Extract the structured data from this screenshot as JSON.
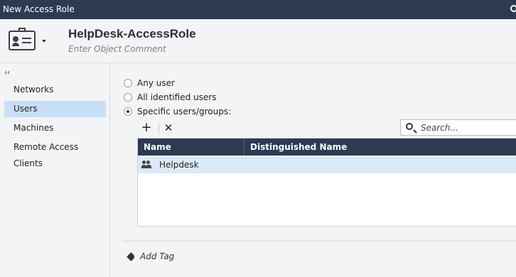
{
  "window": {
    "title": "New Access Role"
  },
  "header": {
    "name": "HelpDesk-AccessRole",
    "comment_placeholder": "Enter Object Comment"
  },
  "sidebar": {
    "collapse_glyph": "‹‹",
    "items": [
      {
        "label": "Networks",
        "active": false
      },
      {
        "label": "Users",
        "active": true
      },
      {
        "label": "Machines",
        "active": false
      },
      {
        "label": "Remote Access Clients",
        "active": false
      }
    ]
  },
  "users": {
    "options": [
      {
        "label": "Any user",
        "checked": false
      },
      {
        "label": "All identified users",
        "checked": false
      },
      {
        "label": "Specific users/groups:",
        "checked": true
      }
    ],
    "toolbar": {
      "add_glyph": "+",
      "remove_glyph": "✕"
    },
    "search": {
      "placeholder": "Search..."
    },
    "table": {
      "columns": [
        "Name",
        "Distinguished Name"
      ],
      "rows": [
        {
          "name": "Helpdesk",
          "dn": "",
          "icon": "group-icon",
          "selected": true
        }
      ]
    }
  },
  "footer": {
    "add_tag_label": "Add Tag"
  },
  "colors": {
    "titlebar": "#2d3b52",
    "selection": "#c8e0f7",
    "row_selection": "#dbeaf8"
  }
}
